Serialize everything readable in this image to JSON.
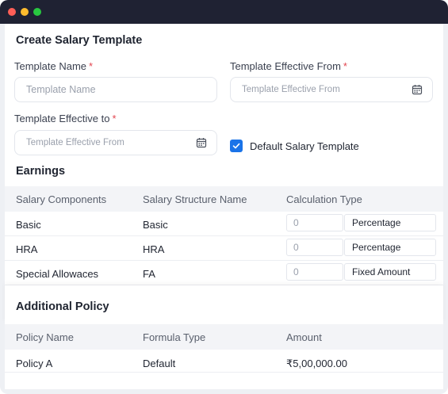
{
  "form": {
    "title": "Create Salary Template",
    "template_name": {
      "label": "Template Name",
      "required": "*",
      "placeholder": "Template Name"
    },
    "effective_from": {
      "label": "Template Effective From",
      "required": "*",
      "placeholder": "Template Effective From"
    },
    "effective_to": {
      "label": "Template Effective to",
      "required": "*",
      "placeholder": "Template Effective From"
    },
    "default_checkbox": {
      "label": "Default Salary Template",
      "checked": true
    }
  },
  "earnings": {
    "title": "Earnings",
    "columns": [
      "Salary Components",
      "Salary Structure Name",
      "Calculation Type"
    ],
    "rows": [
      {
        "component": "Basic",
        "structure": "Basic",
        "value": "0",
        "type": "Percentage"
      },
      {
        "component": "HRA",
        "structure": "HRA",
        "value": "0",
        "type": "Percentage"
      },
      {
        "component": "Special Allowaces",
        "structure": "FA",
        "value": "0",
        "type": "Fixed Amount"
      }
    ]
  },
  "policy": {
    "title": "Additional Policy",
    "columns": [
      "Policy Name",
      "Formula Type",
      "Amount"
    ],
    "rows": [
      {
        "name": "Policy A",
        "formula": "Default",
        "amount": "₹5,00,000.00"
      }
    ]
  },
  "colors": {
    "accent": "#1a73e8",
    "required": "#e2454f",
    "titlebar": "#1f2233"
  },
  "icons": {
    "calendar": "calendar-icon",
    "check": "check-icon"
  }
}
